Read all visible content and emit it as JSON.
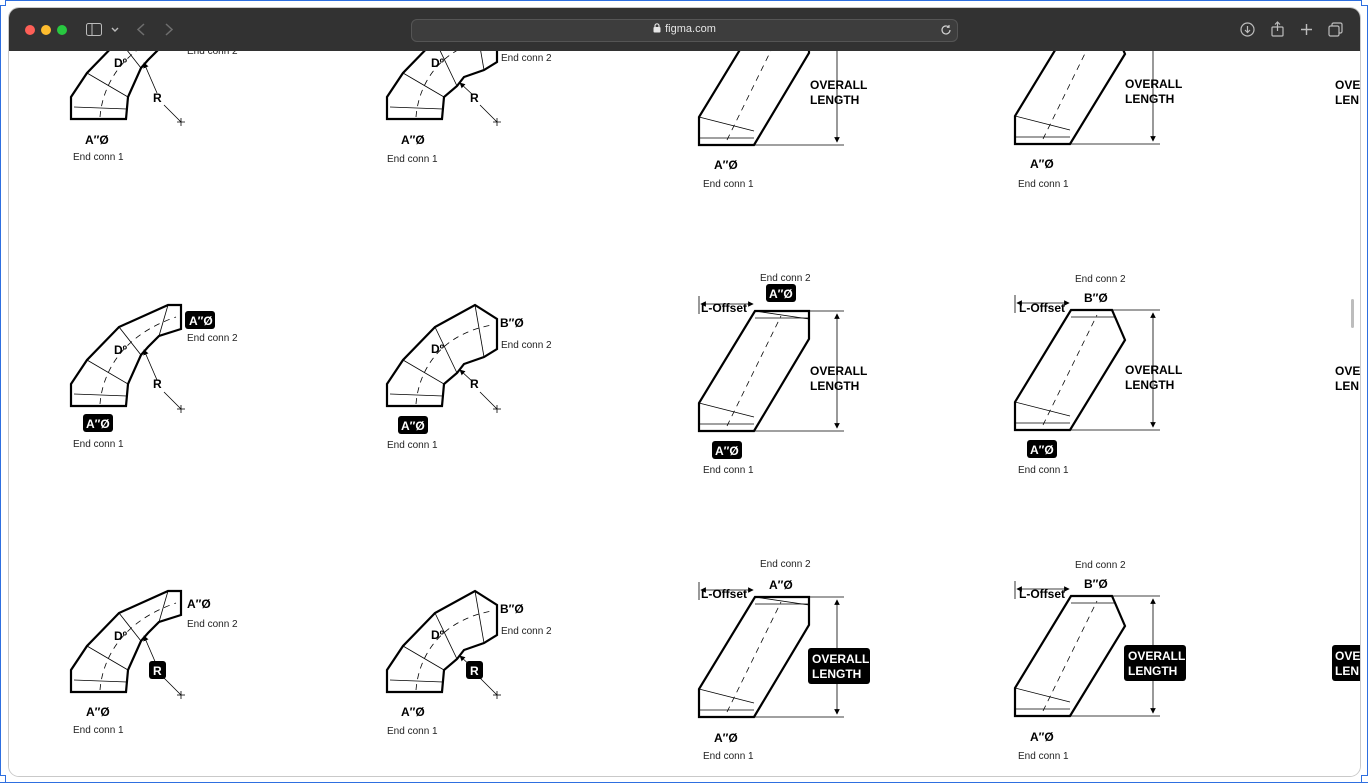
{
  "browser": {
    "url": "figma.com",
    "colors": {
      "close": "#fe5f57",
      "minimize": "#febc2e",
      "zoom": "#28c840",
      "selection": "#2e6fe0"
    },
    "icons": [
      "sidebar-icon",
      "chevron-down-icon",
      "back-icon",
      "forward-icon",
      "lock-icon",
      "reload-icon",
      "download-icon",
      "share-icon",
      "plus-icon",
      "tabs-icon"
    ]
  },
  "labels": {
    "end_conn_1": "End conn 1",
    "end_conn_2": "End conn 2",
    "a_dia": "A″Ø",
    "b_dia": "B″Ø",
    "angle": "Dº",
    "radius": "R",
    "l_offset": "L-Offset",
    "overall": "OVERALL",
    "length": "LENGTH",
    "overall_cut": "OVE",
    "length_cut": "LEN"
  }
}
